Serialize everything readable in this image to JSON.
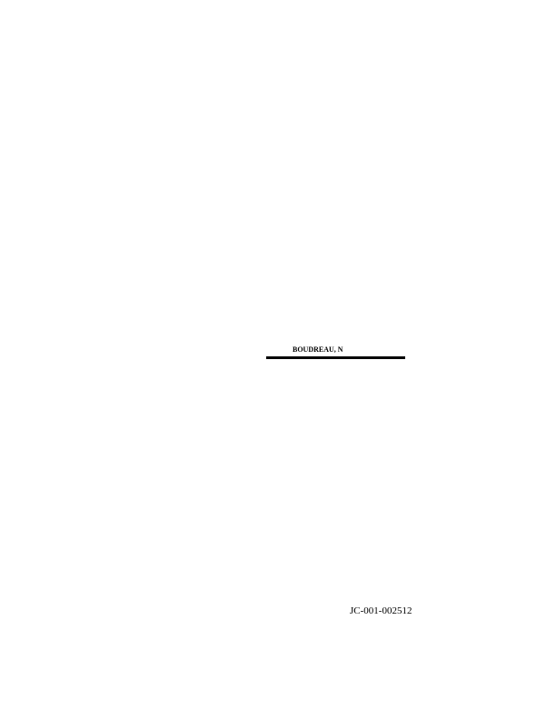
{
  "document": {
    "name_label": "BOUDREAU, N",
    "doc_id": "JC-001-002512"
  }
}
